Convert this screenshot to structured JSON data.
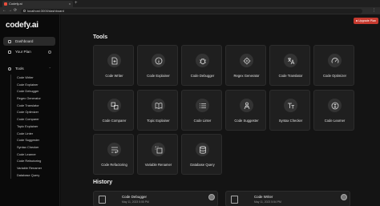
{
  "browser": {
    "tab_title": "Codefy.ai",
    "new_tab_symbol": "+",
    "tab_close_symbol": "x",
    "url": "localhost:3000/dashboard",
    "back_symbol": "←",
    "forward_symbol": "→",
    "reload_symbol": "⟳",
    "menu_symbol": "⋮"
  },
  "sidebar": {
    "logo_main": "codefy.",
    "logo_accent": "ai",
    "items": [
      {
        "label": "Dashboard",
        "icon": "dashboard-icon",
        "active": true
      },
      {
        "label": "Your Plan",
        "icon": "plan-icon",
        "active": false
      }
    ],
    "tools_label": "Tools",
    "chevron": "⌃",
    "tool_links": [
      "Code Writer",
      "Code Explainer",
      "Code Debugger",
      "Regex Generator",
      "Code Translator",
      "Code Optimizer",
      "Code Comparer",
      "Topic Explainer",
      "Code Linter",
      "Code Suggester",
      "Syntax Checker",
      "Code Learner",
      "Code Refactoring",
      "Variable Renamer",
      "Database Query"
    ]
  },
  "main": {
    "upgrade_label": "Upgrade Plan",
    "tools_title": "Tools",
    "tools": [
      {
        "label": "Code Writer",
        "icon": "file-plus-icon"
      },
      {
        "label": "Code Explainer",
        "icon": "info-icon"
      },
      {
        "label": "Code Debugger",
        "icon": "bug-icon"
      },
      {
        "label": "Regex Generator",
        "icon": "regex-target-icon"
      },
      {
        "label": "Code Translator",
        "icon": "translate-icon"
      },
      {
        "label": "Code Optimizer",
        "icon": "gauge-icon"
      },
      {
        "label": "Code Comparer",
        "icon": "compare-icon"
      },
      {
        "label": "Topic Explainer",
        "icon": "book-icon"
      },
      {
        "label": "Code Linter",
        "icon": "list-icon"
      },
      {
        "label": "Code Suggester",
        "icon": "person-icon"
      },
      {
        "label": "Syntax Checker",
        "icon": "text-icon"
      },
      {
        "label": "Code Learner",
        "icon": "lightbulb-icon"
      },
      {
        "label": "Code Refactoring",
        "icon": "wrap-icon"
      },
      {
        "label": "Variable Renamer",
        "icon": "rename-icon"
      },
      {
        "label": "Database Query",
        "icon": "database-icon"
      }
    ],
    "history_title": "History",
    "history": [
      {
        "title": "Code Debugger",
        "date": "May 11, 2023 5:55 PM"
      },
      {
        "title": "Code Writer",
        "date": "May 11, 2023 5:54 PM"
      }
    ]
  }
}
